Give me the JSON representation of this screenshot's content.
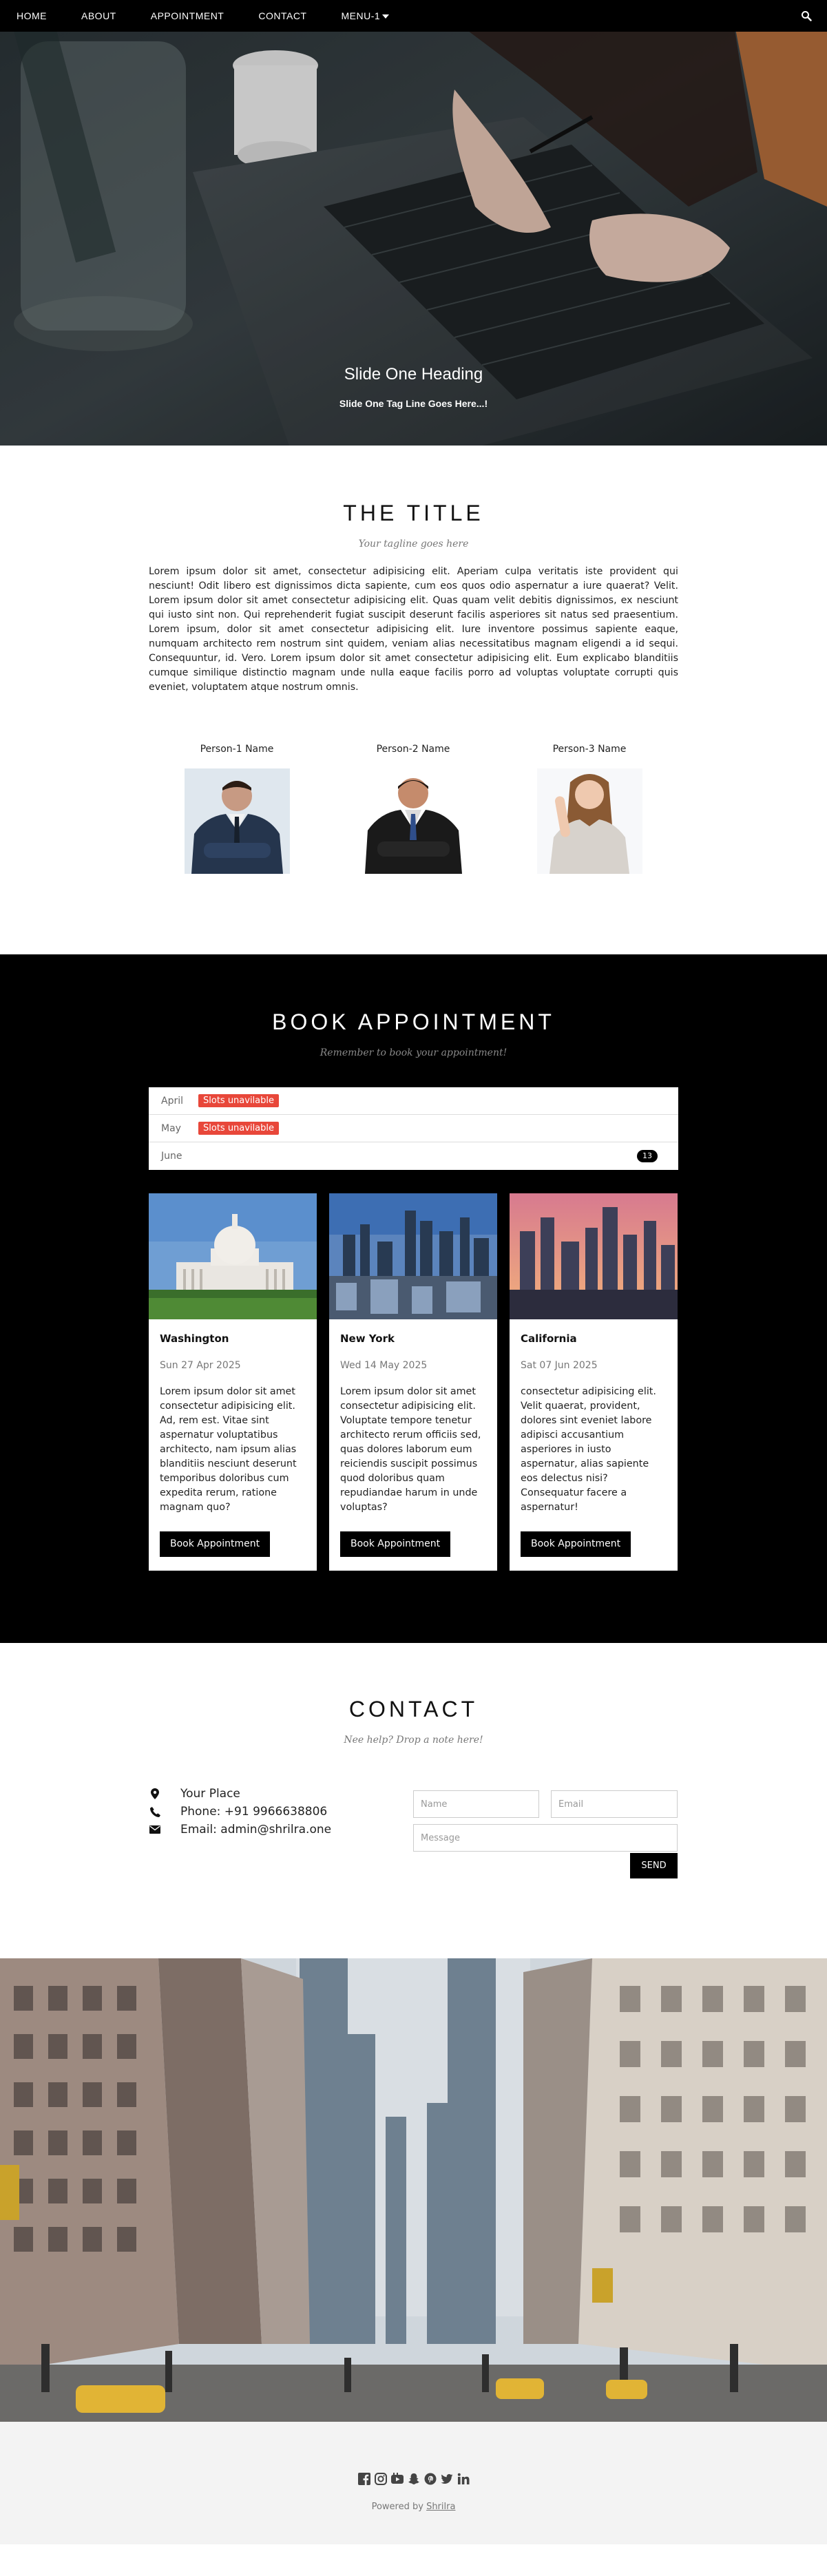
{
  "nav": {
    "items": [
      "HOME",
      "ABOUT",
      "APPOINTMENT",
      "CONTACT",
      "MENU-1"
    ]
  },
  "hero": {
    "heading": "Slide One Heading",
    "tagline": "Slide One Tag Line Goes Here...!"
  },
  "about": {
    "title": "THE TITLE",
    "tagline": "Your tagline goes here",
    "text": "Lorem ipsum dolor sit amet, consectetur adipisicing elit. Aperiam culpa veritatis iste provident qui nesciunt! Odit libero est dignissimos dicta sapiente, cum eos quos odio aspernatur a iure quaerat? Velit. Lorem ipsum dolor sit amet consectetur adipisicing elit. Quas quam velit debitis dignissimos, ex nesciunt qui iusto sint non. Qui reprehenderit fugiat suscipit deserunt facilis asperiores sit natus sed praesentium. Lorem ipsum, dolor sit amet consectetur adipisicing elit. Iure inventore possimus sapiente eaque, numquam architecto rem nostrum sint quidem, veniam alias necessitatibus magnam eligendi a id sequi. Consequuntur, id. Vero. Lorem ipsum dolor sit amet consectetur adipisicing elit. Eum explicabo blanditiis cumque similique distinctio magnam unde nulla eaque facilis porro ad voluptas voluptate corrupti quis eveniet, voluptatem atque nostrum omnis.",
    "people": [
      {
        "name": "Person-1 Name"
      },
      {
        "name": "Person-2 Name"
      },
      {
        "name": "Person-3 Name"
      }
    ]
  },
  "appointment": {
    "title": "BOOK APPOINTMENT",
    "tagline": "Remember to book your appointment!",
    "months": [
      {
        "name": "April",
        "status": "Slots unavilable"
      },
      {
        "name": "May",
        "status": "Slots unavilable"
      },
      {
        "name": "June",
        "count": "13"
      }
    ],
    "cards": [
      {
        "title": "Washington",
        "date": "Sun 27 Apr 2025",
        "text": "Lorem ipsum dolor sit amet consectetur adipisicing elit. Ad, rem est. Vitae sint aspernatur voluptatibus architecto, nam ipsum alias blanditiis nesciunt deserunt temporibus doloribus cum expedita rerum, ratione magnam quo?",
        "button": "Book Appointment"
      },
      {
        "title": "New York",
        "date": "Wed 14 May 2025",
        "text": "Lorem ipsum dolor sit amet consectetur adipisicing elit. Voluptate tempore tenetur architecto rerum officiis sed, quas dolores laborum eum reiciendis suscipit possimus quod doloribus quam repudiandae harum in unde voluptas?",
        "button": "Book Appointment"
      },
      {
        "title": "California",
        "date": "Sat 07 Jun 2025",
        "text": "consectetur adipisicing elit. Velit quaerat, provident, dolores sint eveniet labore adipisci accusantium asperiores in iusto aspernatur, alias sapiente eos delectus nisi? Consequatur facere a aspernatur!",
        "button": "Book Appointment"
      }
    ]
  },
  "contact": {
    "title": "CONTACT",
    "tagline": "Nee help? Drop a note here!",
    "place": "Your Place",
    "phone": "Phone: +91 9966638806",
    "email": "Email: admin@shrilra.one",
    "name_placeholder": "Name",
    "email_placeholder": "Email",
    "message_placeholder": "Message",
    "send": "SEND"
  },
  "footer": {
    "social_icons": [
      "facebook-icon",
      "instagram-icon",
      "youtube-icon",
      "snapchat-icon",
      "pinterest-icon",
      "twitter-icon",
      "linkedin-icon"
    ],
    "powered_prefix": "Powered by",
    "powered_link": "Shrilra"
  }
}
